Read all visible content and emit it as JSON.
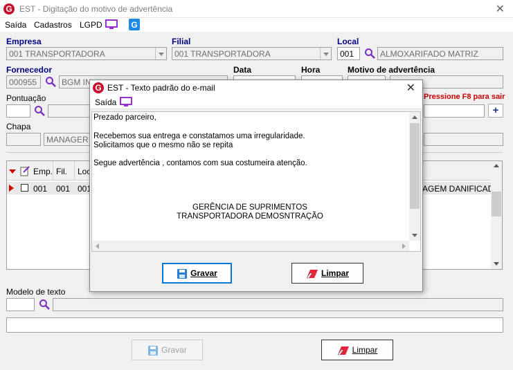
{
  "window": {
    "title": "EST - Digitação do motivo de advertência",
    "logo": "G"
  },
  "menu": {
    "saida": "Saída",
    "cadastros": "Cadastros",
    "lgpd": "LGPD"
  },
  "form": {
    "empresa_label": "Empresa",
    "empresa_value": "001 TRANSPORTADORA",
    "filial_label": "Filial",
    "filial_value": "001 TRANSPORTADORA",
    "local_label": "Local",
    "local_code": "001",
    "local_name": "ALMOXARIFADO MATRIZ",
    "fornecedor_label": "Fornecedor",
    "fornecedor_code": "000955",
    "fornecedor_name": "BGM IN",
    "data_label": "Data",
    "hora_label": "Hora",
    "motivo_label": "Motivo de advertência",
    "pontuacao_label": "Pontuação",
    "f8_hint": "Pressione F8 para sair",
    "chapa_label": "Chapa",
    "chapa_name": "MANAGER",
    "modelo_label": "Modelo de texto"
  },
  "grid": {
    "headers": [
      "Emp.",
      "Fil.",
      "Loc"
    ],
    "row": {
      "emp": "001",
      "fil": "001",
      "loc": "001",
      "motivo": "AGEM DANIFICADA"
    }
  },
  "buttons": {
    "gravar": "Gravar",
    "limpar": "Limpar",
    "plus": "+"
  },
  "dialog": {
    "title": "EST - Texto padrão do e-mail",
    "menu_saida": "Saída",
    "lines": [
      "Prezado parceiro,",
      "Recebemos sua entrega e constatamos uma irregularidade.",
      "Solicitamos que o mesmo não se repita",
      "Segue advertência , contamos com sua costumeira atenção."
    ],
    "sign1": "GERÊNCIA DE SUPRIMENTOS",
    "sign2": "TRANSPORTADORA DEMOSNTRAÇÃO",
    "gravar": "Gravar",
    "limpar": "Limpar"
  },
  "colors": {
    "accent": "#0078d7",
    "brand": "#c8102e",
    "label_blue": "#000080",
    "hint_red": "#cc0000"
  }
}
